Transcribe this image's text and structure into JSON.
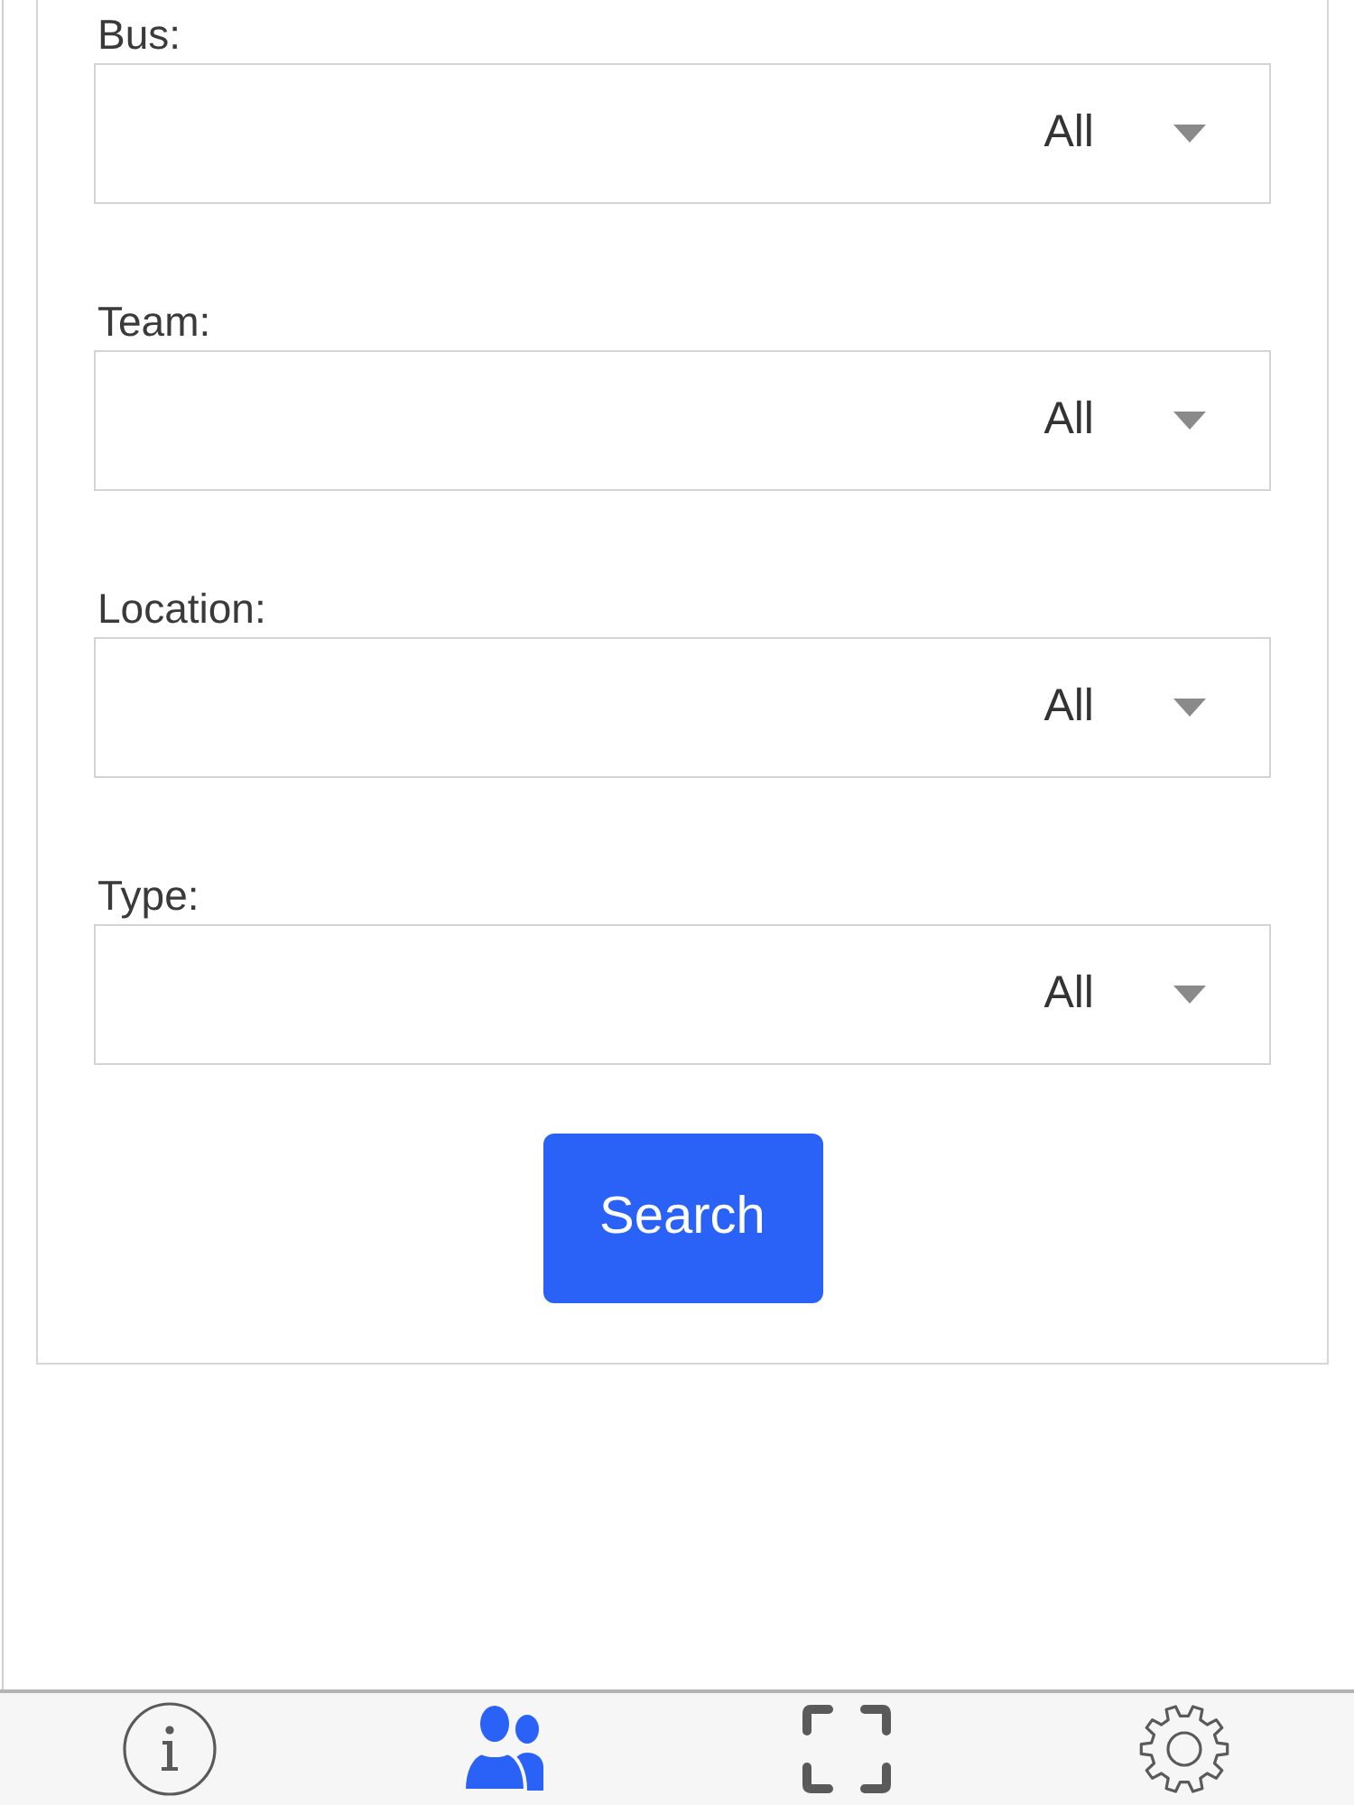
{
  "filters": [
    {
      "label": "Bus:",
      "value": "All"
    },
    {
      "label": "Team:",
      "value": "All"
    },
    {
      "label": "Location:",
      "value": "All"
    },
    {
      "label": "Type:",
      "value": "All"
    }
  ],
  "search_button": {
    "label": "Search"
  },
  "tabs": [
    {
      "selected": false
    },
    {
      "selected": true
    },
    {
      "selected": false
    },
    {
      "selected": false
    }
  ]
}
